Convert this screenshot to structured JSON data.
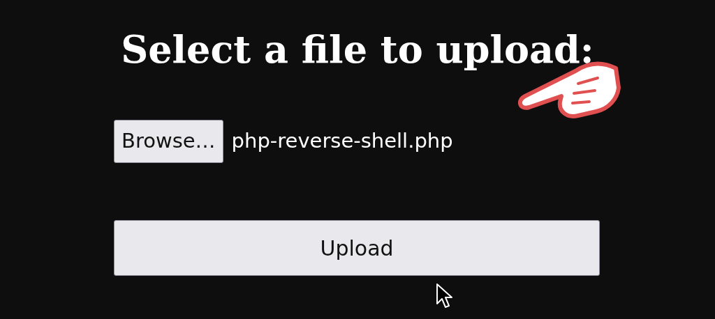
{
  "title": "Select a file to upload:",
  "file_input": {
    "button_label": "Browse…",
    "filename": "php-reverse-shell.php"
  },
  "submit_button": {
    "label": "Upload"
  }
}
